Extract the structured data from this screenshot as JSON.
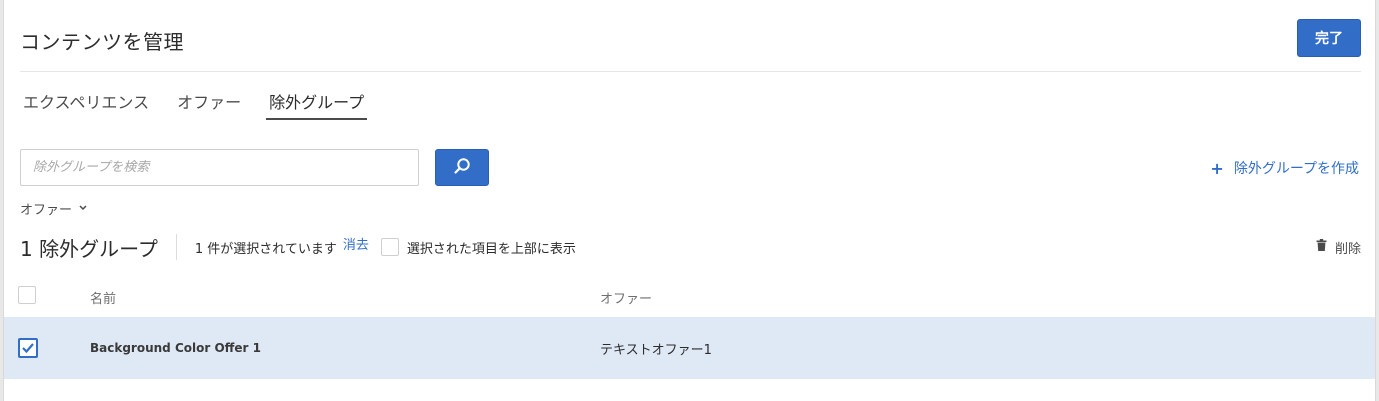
{
  "header": {
    "title": "コンテンツを管理",
    "done_label": "完了"
  },
  "tabs": [
    {
      "label": "エクスペリエンス"
    },
    {
      "label": "オファー"
    },
    {
      "label": "除外グループ"
    }
  ],
  "search": {
    "placeholder": "除外グループを検索"
  },
  "create": {
    "plus": "+",
    "label": "除外グループを作成"
  },
  "filter": {
    "label": "オファー"
  },
  "summary": {
    "count": "1 除外グループ",
    "selected_text": "1 件が選択されています",
    "clear_label": "消去",
    "show_top_label": "選択された項目を上部に表示",
    "delete_label": "削除"
  },
  "table": {
    "columns": [
      "名前",
      "オファー"
    ],
    "rows": [
      {
        "name": "Background Color Offer 1",
        "offer": "テキストオファー1",
        "selected": true
      }
    ]
  },
  "colors": {
    "accent": "#326ec8",
    "selected_row": "#dfe8f5"
  }
}
